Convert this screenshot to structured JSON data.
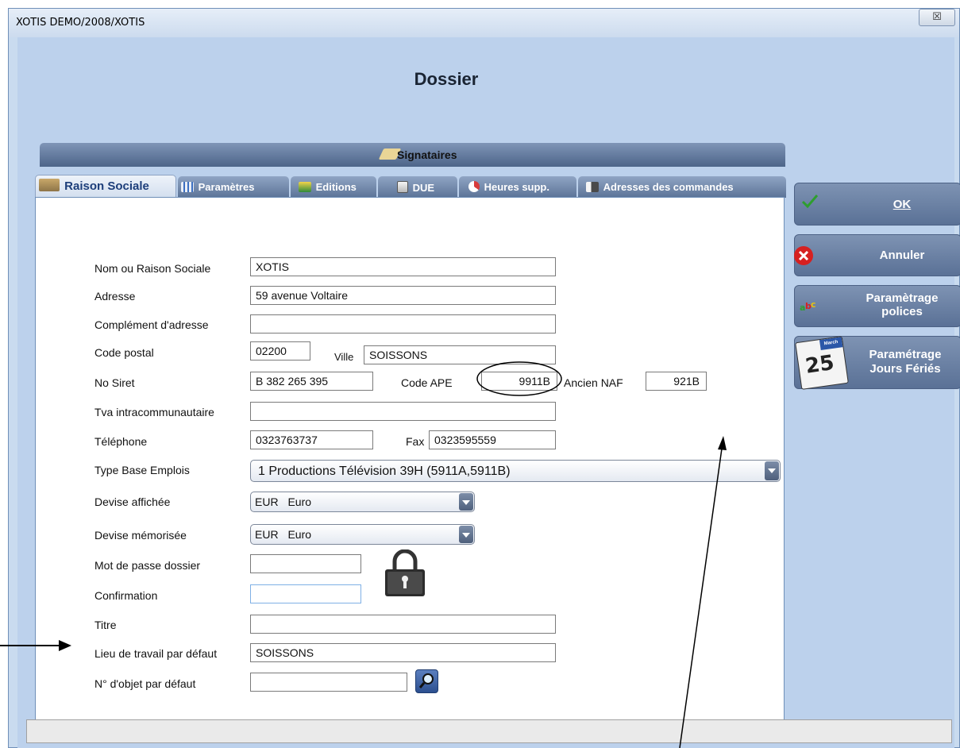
{
  "window": {
    "title": "XOTIS DEMO/2008/XOTIS",
    "close_glyph": "☒"
  },
  "heading": "Dossier",
  "signataires_tab": {
    "label": "Signataires",
    "icon": "pen-signature-icon"
  },
  "tabs": [
    {
      "label": "Raison Sociale",
      "icon": "building-list-icon",
      "active": true
    },
    {
      "label": "Paramètres",
      "icon": "grid-settings-icon"
    },
    {
      "label": "Editions",
      "icon": "print-magnifier-icon"
    },
    {
      "label": "DUE",
      "icon": "documents-stack-icon"
    },
    {
      "label": "Heures supp.",
      "icon": "clock-pie-icon"
    },
    {
      "label": "Adresses des commandes",
      "icon": "address-book-icon"
    }
  ],
  "form": {
    "nom_label": "Nom ou Raison Sociale",
    "nom_value": "XOTIS",
    "adresse_label": "Adresse",
    "adresse_value": "59 avenue Voltaire",
    "complement_label": "Complément d'adresse",
    "complement_value": "",
    "cp_label": "Code postal",
    "cp_value": "02200",
    "ville_label": "Ville",
    "ville_value": "SOISSONS",
    "siret_label": "No Siret",
    "siret_value": "B 382 265 395",
    "ape_label": "Code APE",
    "ape_value": "9911B",
    "naf_label": "Ancien NAF",
    "naf_value": "921B",
    "tva_label": "Tva intracommunautaire",
    "tva_value": "",
    "tel_label": "Téléphone",
    "tel_value": "0323763737",
    "fax_label": "Fax",
    "fax_value": "0323595559",
    "type_base_label": "Type Base Emplois",
    "type_base_value": "1 Productions Télévision 39H (5911A,5911B)",
    "devise_aff_label": "Devise affichée",
    "devise_aff_code": "EUR",
    "devise_aff_name": "Euro",
    "devise_mem_label": "Devise mémorisée",
    "devise_mem_code": "EUR",
    "devise_mem_name": "Euro",
    "mdp_label": "Mot de passe dossier",
    "mdp_value": "",
    "confirm_label": "Confirmation",
    "confirm_value": "",
    "titre_label": "Titre",
    "titre_value": "",
    "lieu_label": "Lieu de travail par défaut",
    "lieu_value": "SOISSONS",
    "objet_label": "N° d'objet par défaut",
    "objet_value": ""
  },
  "buttons": {
    "ok": "OK",
    "annuler": "Annuler",
    "polices_line1": "Paramètrage",
    "polices_line2": "polices",
    "feries_line1": "Paramétrage",
    "feries_line2": "Jours Fériés",
    "calendar_day": "25",
    "calendar_month": "March"
  },
  "colors": {
    "accent": "#5a7196",
    "ok_check": "#2e9e2e",
    "cancel_red": "#d62020"
  }
}
